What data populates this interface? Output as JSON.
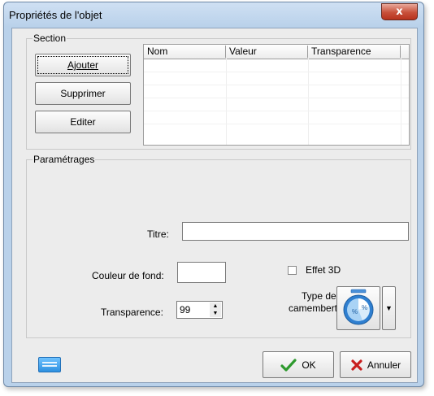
{
  "window": {
    "title": "Propriétés de l'objet",
    "close_glyph": "x"
  },
  "section": {
    "label": "Section",
    "buttons": {
      "add": "Ajouter",
      "delete": "Supprimer",
      "edit": "Editer"
    },
    "table": {
      "columns": [
        "Nom",
        "Valeur",
        "Transparence"
      ],
      "rows": []
    }
  },
  "settings": {
    "label": "Paramétrages",
    "title_label": "Titre:",
    "title_value": "",
    "bg_color_label": "Couleur de fond:",
    "bg_color_value": "#ffffff",
    "effect3d_label": "Effet 3D",
    "effect3d_checked": false,
    "transparency_label": "Transparence:",
    "transparency_value": "99",
    "pie_type_label_line1": "Type de",
    "pie_type_label_line2": "camembert:",
    "pie_icon": "pie-chart-icon"
  },
  "footer": {
    "ok_label": "OK",
    "cancel_label": "Annuler",
    "ok_icon": "check-icon",
    "cancel_icon": "x-mark-icon",
    "keyboard_icon": "keyboard-icon"
  },
  "colors": {
    "frame": "#b9d1ea",
    "client": "#ececec",
    "close_button": "#c8503a",
    "ok_check": "#2e9a2e",
    "cancel_x": "#c81e1e",
    "keyboard": "#2d8fe0"
  }
}
